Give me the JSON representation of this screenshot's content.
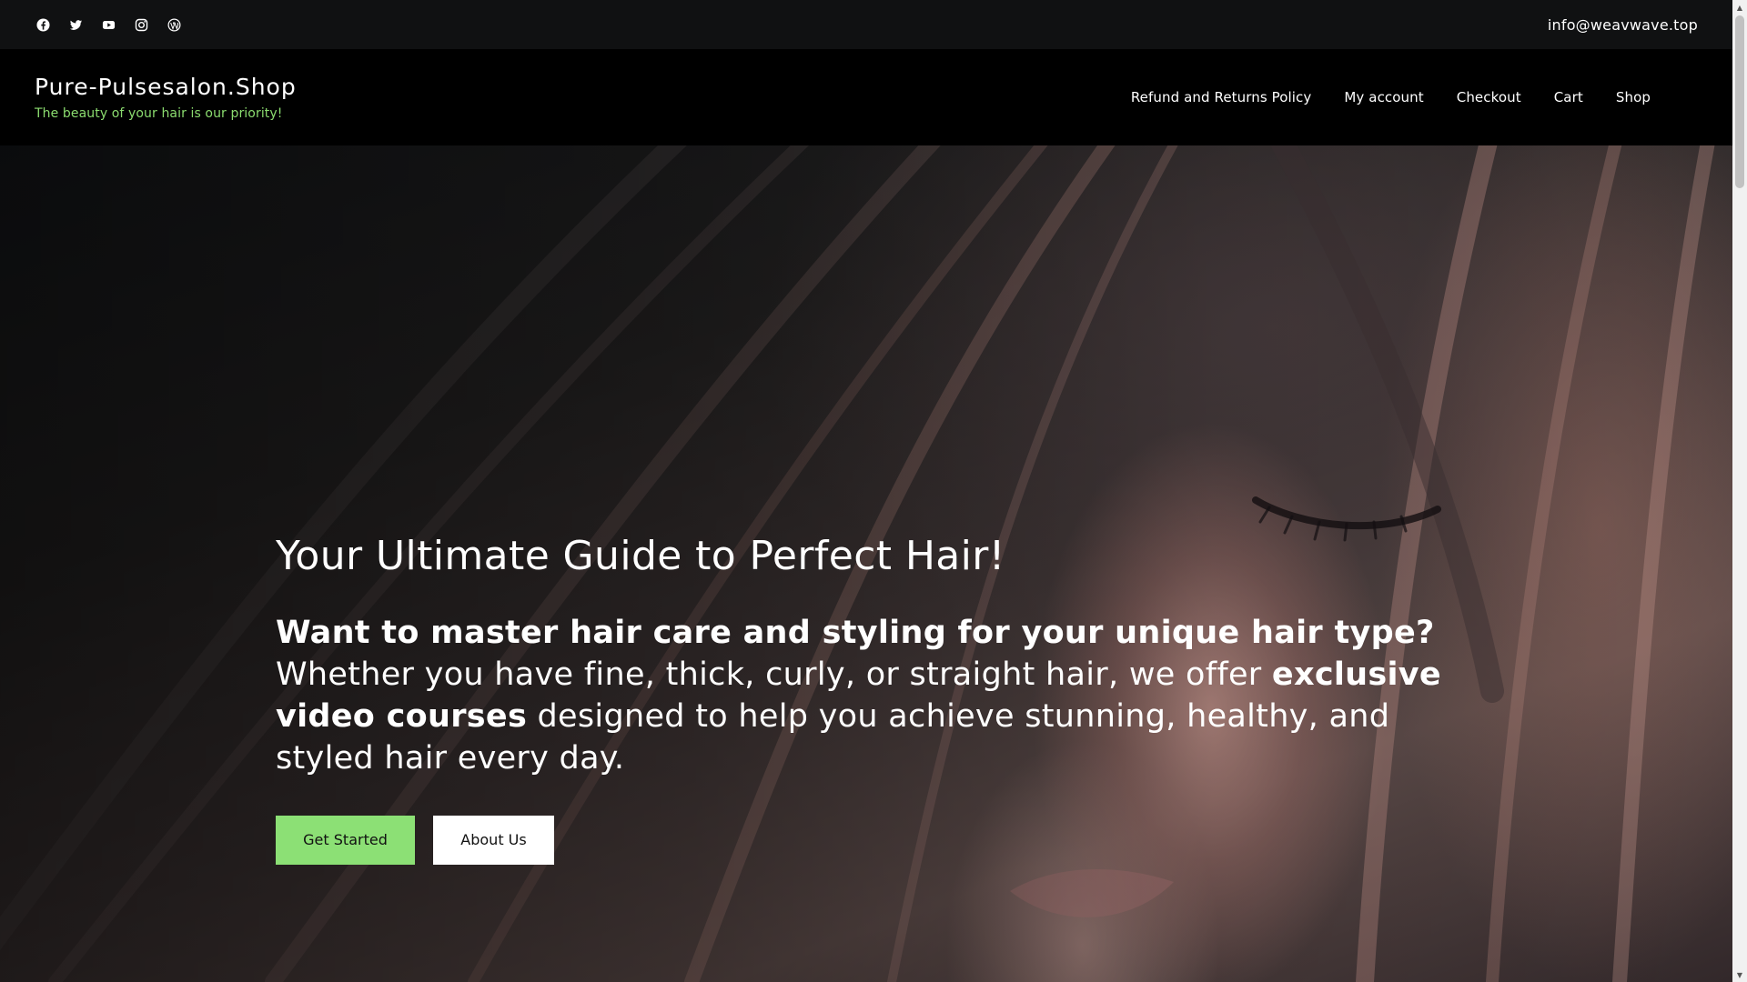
{
  "topbar": {
    "social_icons": [
      "facebook-icon",
      "twitter-icon",
      "youtube-icon",
      "instagram-icon",
      "wordpress-icon"
    ],
    "email": "info@weavwave.top"
  },
  "header": {
    "site_title": "Pure-Pulsesalon.Shop",
    "tagline": "The beauty of your hair is our priority!",
    "nav": [
      {
        "label": "Refund and Returns Policy"
      },
      {
        "label": "My account"
      },
      {
        "label": "Checkout"
      },
      {
        "label": "Cart"
      },
      {
        "label": "Shop"
      }
    ]
  },
  "hero": {
    "title": "Your Ultimate Guide to Perfect Hair!",
    "text_bold_1": "Want to master hair care and styling for your unique hair type?",
    "text_regular_1": " Whether you have fine, thick, curly, or straight hair, we offer ",
    "text_bold_2": "exclusive video courses",
    "text_regular_2": " designed to help you achieve stunning, healthy, and styled hair every day.",
    "primary_button": "Get Started",
    "secondary_button": "About Us"
  },
  "colors": {
    "accent_green": "#8ce075",
    "tagline_green": "#8bdc6f",
    "topbar_bg": "#101112",
    "header_bg": "#000000"
  }
}
